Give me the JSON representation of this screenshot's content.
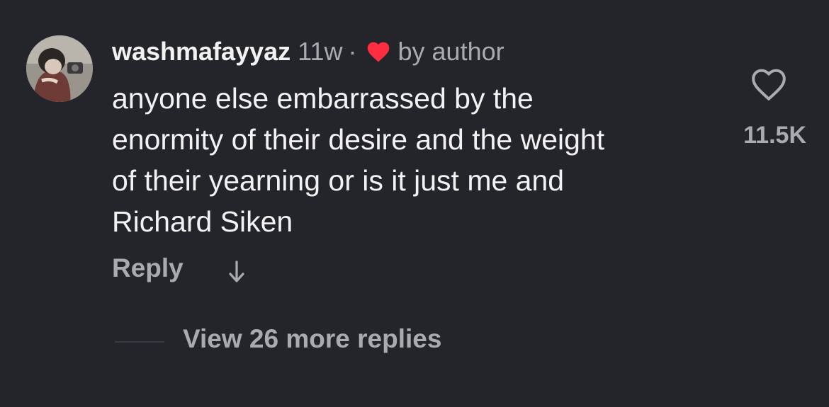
{
  "comment": {
    "username": "washmafayyaz",
    "time": "11w",
    "separator": "·",
    "author_label": "by author",
    "text_lines": [
      "anyone else embarrassed by the",
      "enormity of their desire and the weight",
      "of their yearning or is it just me and",
      "Richard Siken"
    ],
    "like_count": "11.5K",
    "reply_label": "Reply",
    "view_replies_label": "View 26 more replies"
  },
  "icons": {
    "author_heart": "heart-filled-icon",
    "like": "heart-outline-icon",
    "expand": "arrow-down-icon",
    "avatar": "user-avatar"
  },
  "colors": {
    "background": "#24252b",
    "primary_text": "#f2f2f2",
    "secondary_text": "#a9abb1",
    "heart_red": "#ff2d40"
  }
}
